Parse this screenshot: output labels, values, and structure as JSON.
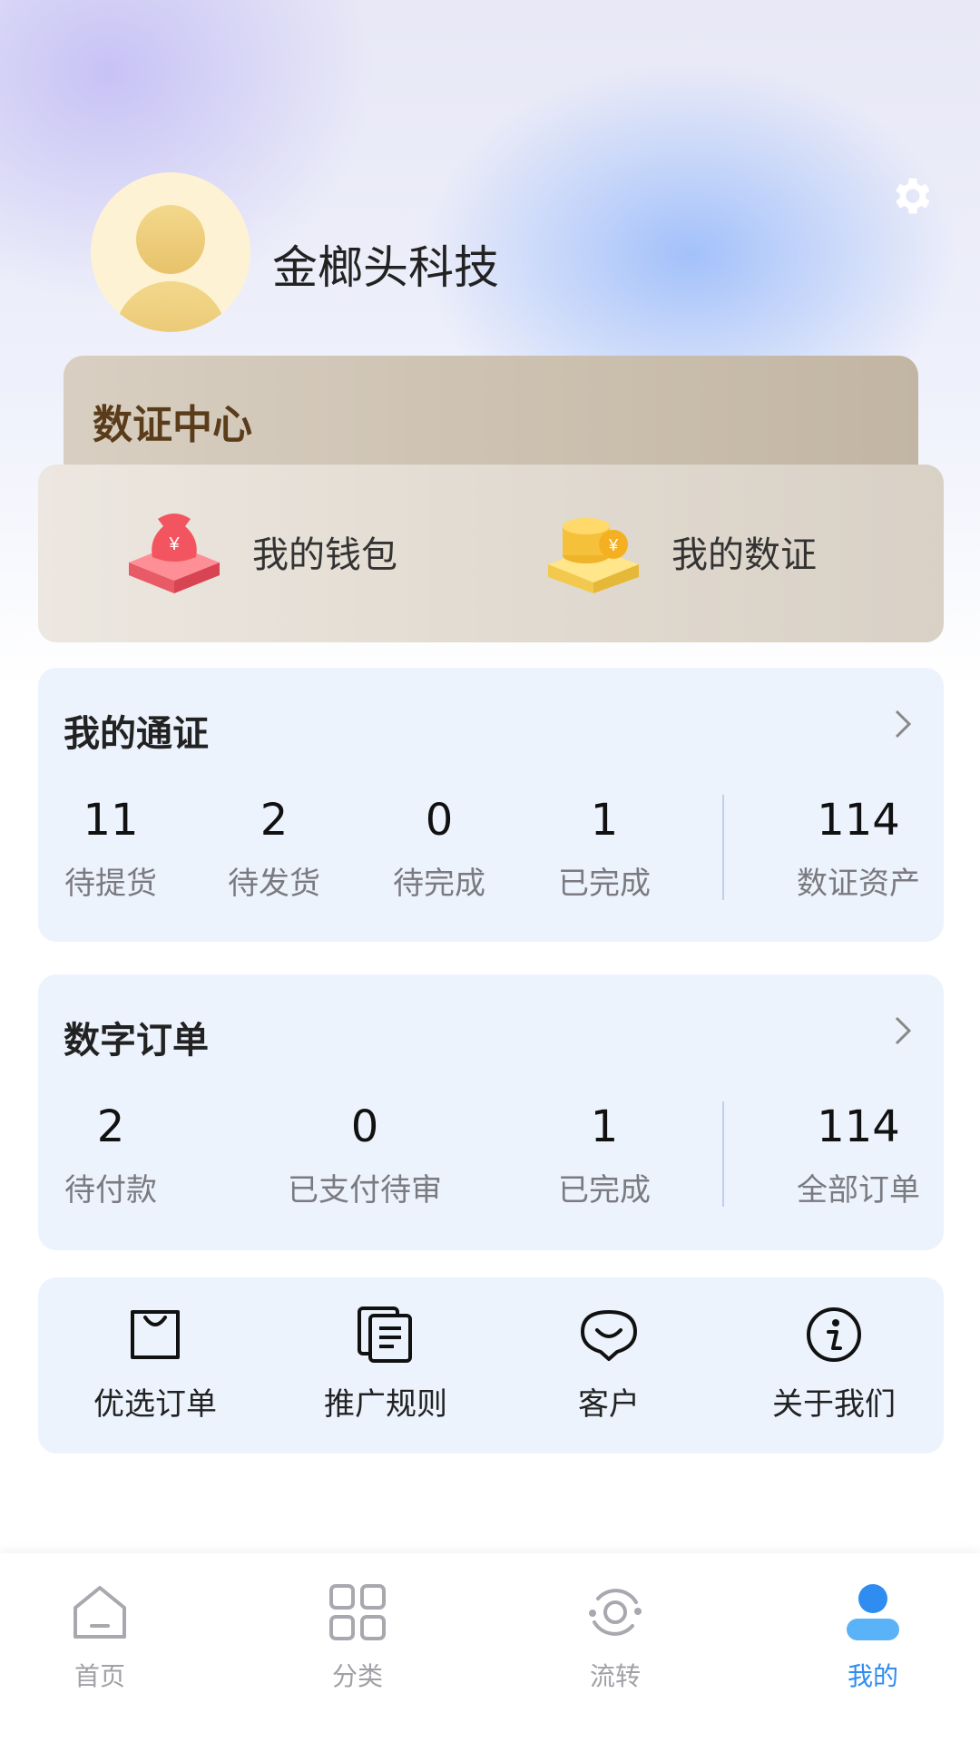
{
  "profile": {
    "name": "金榔头科技"
  },
  "vault": {
    "title": "数证中心",
    "items": [
      {
        "label": "我的钱包",
        "icon": "money-bag-icon"
      },
      {
        "label": "我的数证",
        "icon": "coin-stack-icon"
      }
    ]
  },
  "passes": {
    "title": "我的通证",
    "stats": [
      {
        "value": "11",
        "label": "待提货"
      },
      {
        "value": "2",
        "label": "待发货"
      },
      {
        "value": "0",
        "label": "待完成"
      },
      {
        "value": "1",
        "label": "已完成"
      }
    ],
    "total": {
      "value": "114",
      "label": "数证资产"
    }
  },
  "orders": {
    "title": "数字订单",
    "stats": [
      {
        "value": "2",
        "label": "待付款"
      },
      {
        "value": "0",
        "label": "已支付待审"
      },
      {
        "value": "1",
        "label": "已完成"
      }
    ],
    "total": {
      "value": "114",
      "label": "全部订单"
    }
  },
  "services": [
    {
      "label": "优选订单",
      "icon": "shopping-bag-icon"
    },
    {
      "label": "推广规则",
      "icon": "documents-icon"
    },
    {
      "label": "客户",
      "icon": "chat-smile-icon"
    },
    {
      "label": "关于我们",
      "icon": "info-icon"
    }
  ],
  "tabs": [
    {
      "label": "首页",
      "icon": "home-icon",
      "active": false
    },
    {
      "label": "分类",
      "icon": "grid-icon",
      "active": false
    },
    {
      "label": "流转",
      "icon": "cycle-icon",
      "active": false
    },
    {
      "label": "我的",
      "icon": "person-icon",
      "active": true
    }
  ],
  "colors": {
    "accent": "#2f8cf0",
    "card_bg": "#edf3fd",
    "vault_title": "#5a3c1a"
  }
}
